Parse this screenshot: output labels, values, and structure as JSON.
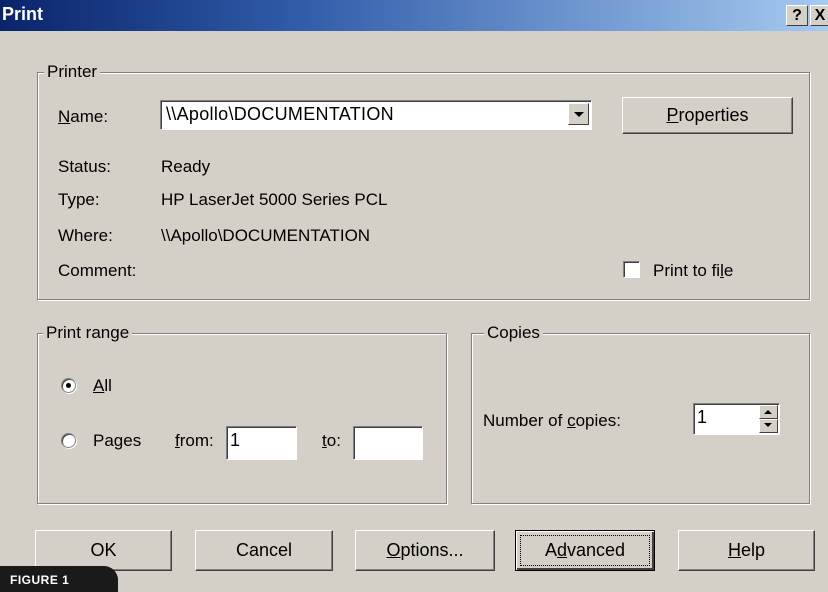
{
  "window": {
    "title": "Print",
    "help_label": "?",
    "close_label": "X"
  },
  "printer": {
    "group_label": "Printer",
    "name_label": "Name:",
    "name_value": "\\\\Apollo\\DOCUMENTATION",
    "properties_label": "Properties",
    "status_label": "Status:",
    "status_value": "Ready",
    "type_label": "Type:",
    "type_value": "HP LaserJet 5000 Series PCL",
    "where_label": "Where:",
    "where_value": "\\\\Apollo\\DOCUMENTATION",
    "comment_label": "Comment:",
    "print_to_file_label": "Print to file",
    "print_to_file_checked": false
  },
  "print_range": {
    "group_label": "Print range",
    "all_label": "All",
    "pages_label": "Pages",
    "from_label": "from:",
    "from_value": "1",
    "to_label": "to:",
    "to_value": "",
    "selected": "All"
  },
  "copies": {
    "group_label": "Copies",
    "number_label": "Number of copies:",
    "number_value": "1"
  },
  "buttons": {
    "ok": "OK",
    "cancel": "Cancel",
    "options": "Options...",
    "advanced": "Advanced",
    "help": "Help"
  },
  "caption": "FIGURE 1",
  "colors": {
    "face": "#d4d0c8",
    "title_start": "#0a246a",
    "title_end": "#a6caf0"
  }
}
